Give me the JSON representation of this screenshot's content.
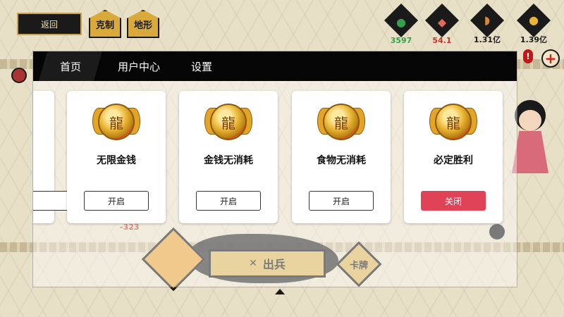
{
  "game": {
    "back_label": "返回",
    "badge_counter": "克制",
    "badge_terrain": "地形",
    "resources": [
      {
        "icon": "soldier-icon",
        "value": "3597",
        "color": "#35a04a"
      },
      {
        "icon": "meat-icon",
        "value": "54.1",
        "color": "#c0392b"
      },
      {
        "icon": "drumstick-icon",
        "value": "1.31亿",
        "color": "#1a1a1a"
      },
      {
        "icon": "coin-icon",
        "value": "1.39亿",
        "color": "#1a1a1a"
      }
    ],
    "deploy_label": "出兵",
    "card_label": "卡牌",
    "loss_value": "-323"
  },
  "menu": {
    "tabs": [
      {
        "label": "首页",
        "active": true
      },
      {
        "label": "用户中心",
        "active": false
      },
      {
        "label": "设置",
        "active": false
      }
    ],
    "cards": [
      {
        "title": "无限金钱",
        "button": "开启",
        "state": "off"
      },
      {
        "title": "金钱无消耗",
        "button": "开启",
        "state": "off"
      },
      {
        "title": "食物无消耗",
        "button": "开启",
        "state": "off"
      },
      {
        "title": "必定胜利",
        "button": "关闭",
        "state": "on"
      }
    ]
  },
  "colors": {
    "accent_red": "#e04358",
    "tab_bar": "#050505",
    "gold": "#d9b45a"
  }
}
